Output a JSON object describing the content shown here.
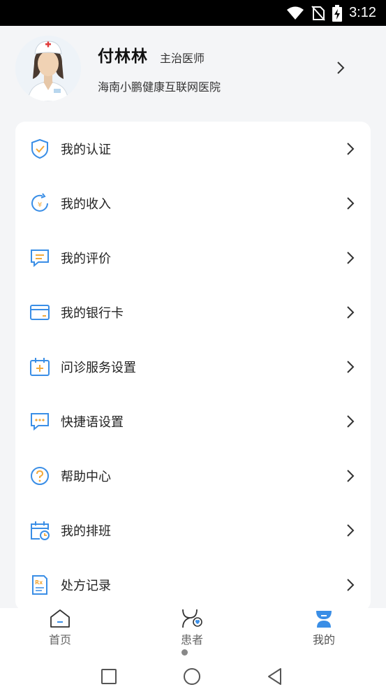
{
  "status_bar": {
    "time": "3:12",
    "icons": [
      "wifi-icon",
      "no-sim-icon",
      "battery-charging-icon"
    ]
  },
  "profile": {
    "name": "付林林",
    "title": "主治医师",
    "hospital": "海南小鹏健康互联网医院",
    "avatar": "nurse-avatar"
  },
  "menu": {
    "items": [
      {
        "label": "我的认证",
        "icon": "shield-check-icon"
      },
      {
        "label": "我的收入",
        "icon": "income-icon"
      },
      {
        "label": "我的评价",
        "icon": "comment-icon"
      },
      {
        "label": "我的银行卡",
        "icon": "bank-card-icon"
      },
      {
        "label": "问诊服务设置",
        "icon": "calendar-plus-icon"
      },
      {
        "label": "快捷语设置",
        "icon": "chat-dots-icon"
      },
      {
        "label": "帮助中心",
        "icon": "help-icon"
      },
      {
        "label": "我的排班",
        "icon": "schedule-icon"
      },
      {
        "label": "处方记录",
        "icon": "prescription-icon"
      }
    ]
  },
  "tabbar": {
    "tabs": [
      {
        "label": "首页",
        "icon": "home-icon",
        "active": false
      },
      {
        "label": "患者",
        "icon": "patient-icon",
        "active": false
      },
      {
        "label": "我的",
        "icon": "my-icon",
        "active": true
      }
    ]
  },
  "colors": {
    "accent": "#3a8ee6",
    "icon_orange": "#f2a93b",
    "page_bg": "#f4f5f7"
  }
}
